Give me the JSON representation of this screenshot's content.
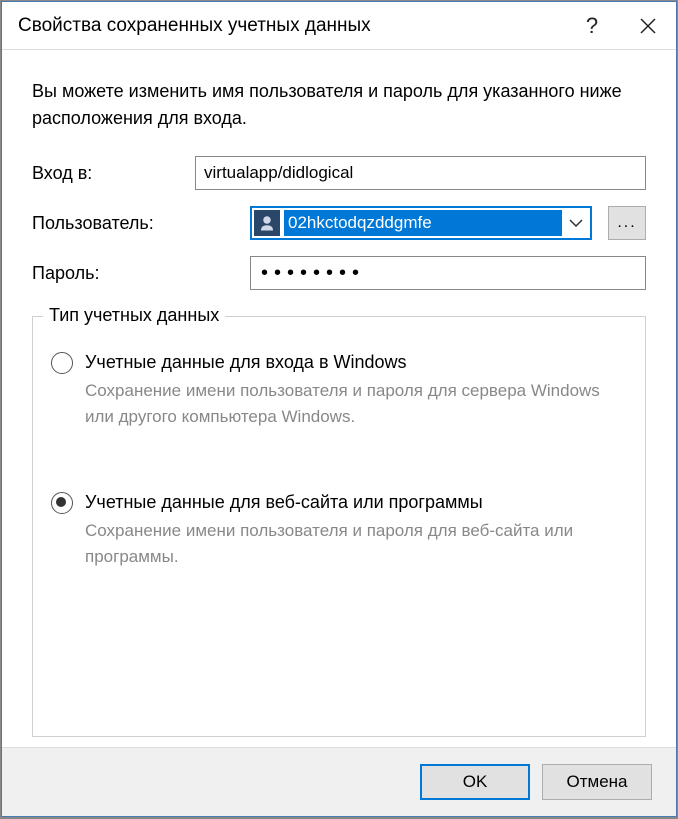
{
  "title": "Свойства сохраненных учетных данных",
  "intro": "Вы можете изменить имя пользователя и пароль для указанного ниже расположения для входа.",
  "fields": {
    "login_to_label": "Вход в:",
    "login_to_value": "virtualapp/didlogical",
    "user_label": "Пользователь:",
    "user_value": "02hkctodqzddgmfe",
    "browse_label": "...",
    "password_label": "Пароль:",
    "password_value": "••••••••"
  },
  "group": {
    "legend": "Тип учетных данных",
    "option1_title": "Учетные данные для входа в Windows",
    "option1_desc": "Сохранение имени пользователя и пароля для сервера Windows или другого компьютера Windows.",
    "option2_title": "Учетные данные для веб-сайта или программы",
    "option2_desc": "Сохранение имени пользователя и пароля для веб-сайта или программы."
  },
  "buttons": {
    "ok": "OK",
    "cancel": "Отмена"
  }
}
